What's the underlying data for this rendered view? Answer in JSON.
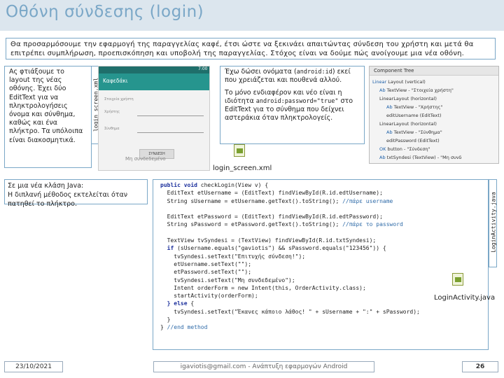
{
  "title": "Οθόνη σύνδεσης (login)",
  "intro": "Θα προσαρμόσουμε την εφαρμογή της παραγγελίας καφέ, έτσι ώστε να ξεκινάει απαιτώντας σύνδεση του χρήστη και μετά θα επιτρέπει συμπλήρωση, προεπισκόπηση και υποβολή της παραγγελίας. Στόχος είναι να δούμε πώς ανοίγουμε μια νέα οθόνη.",
  "left_note": "Ας φτιάξουμε το layout της νέας οθόνης. Έχει δύο EditText για να πληκτρολογήσεις όνομα και σύνθημα, καθώς και ένα πλήκτρο. Τα υπόλοιπα είναι διακοσμητικά.",
  "vertical_label_1": "login_screen.xml",
  "phone": {
    "time": "7:00",
    "app_title": "Καφεδάκι",
    "row1": "Στοιχεία χρήστη",
    "row2": "Χρήστης",
    "row3": "Σύνθημα",
    "button": "ΣΥΝΔΕΣΗ",
    "status": "Μη συνδεδεμένο"
  },
  "callout": {
    "p1_before": "Έχω δώσει ονόματα (",
    "p1_code": "android:id",
    "p1_after": ") εκεί που χρειάζεται και πουθενά αλλού.",
    "p2_before": "Το μόνο ενδιαφέρον και νέο είναι η ιδιότητα ",
    "p2_code": "android:password=\"true\"",
    "p2_after": " στο EditText για το σύνθημα που δείχνει αστεράκια όταν πληκτρολογείς."
  },
  "tree": {
    "header": "Component Tree",
    "items": [
      {
        "tag": "Linear",
        "rest": " Layout (vertical)"
      },
      {
        "tag": "Ab",
        "rest": " TextView - \"Στοιχεία χρήστη\""
      },
      {
        "tag": "",
        "rest": "LinearLayout (horizontal)"
      },
      {
        "tag": "Ab",
        "rest": " TextView - \"Χρήστης\""
      },
      {
        "tag": "",
        "rest": "editUsername (EditText)"
      },
      {
        "tag": "",
        "rest": "LinearLayout (horizontal)"
      },
      {
        "tag": "Ab",
        "rest": " TextView - \"Σύνθημα\""
      },
      {
        "tag": "",
        "rest": "editPassword (EditText)"
      },
      {
        "tag": "OK",
        "rest": " button - \"Σύνδεση\""
      },
      {
        "tag": "Ab",
        "rest": " txtSyndesi (TextView) - \"Μη συνδ"
      }
    ]
  },
  "file1": "login_screen.xml",
  "file2": "LoginActivity.java",
  "class_note_1": "Σε μια νέα κλάση Java:",
  "class_note_2": "Η διπλανή μέθοδος εκτελείται όταν πατηθεί το πλήκτρο.",
  "vertical_label_2": "LoginActivity.java",
  "code": [
    {
      "kw": "public void",
      "rest": " checkLogin(View v) {",
      "cm": ""
    },
    {
      "kw": "",
      "rest": "  EditText etUsername = (EditText) findViewById(R.id.edtUsername);",
      "cm": ""
    },
    {
      "kw": "",
      "rest": "  String sUsername = etUsername.getText().toString(); ",
      "cm": "//πάρε username"
    },
    {
      "kw": "",
      "rest": "",
      "cm": ""
    },
    {
      "kw": "",
      "rest": "  EditText etPassword = (EditText) findViewById(R.id.edtPassword);",
      "cm": ""
    },
    {
      "kw": "",
      "rest": "  String sPassword = etPassword.getText().toString(); ",
      "cm": "//πάρε το password"
    },
    {
      "kw": "",
      "rest": "",
      "cm": ""
    },
    {
      "kw": "",
      "rest": "  TextView tvSyndesi = (TextView) findViewById(R.id.txtSyndesi);",
      "cm": ""
    },
    {
      "kw": "  if",
      "rest": " (sUsername.equals(\"gaviotis\") && sPassword.equals(\"123456\")) {",
      "cm": ""
    },
    {
      "kw": "",
      "rest": "    tvSyndesi.setText(\"Επιτυχής σύνδεση!\");",
      "cm": ""
    },
    {
      "kw": "",
      "rest": "    etUsername.setText(\"\");",
      "cm": ""
    },
    {
      "kw": "",
      "rest": "    etPassword.setText(\"\");",
      "cm": ""
    },
    {
      "kw": "",
      "rest": "    tvSyndesi.setText(\"Μη συνδεδεμένο\");",
      "cm": ""
    },
    {
      "kw": "",
      "rest": "    Intent orderForm = new Intent(this, OrderActivity.class);",
      "cm": ""
    },
    {
      "kw": "",
      "rest": "    startActivity(orderForm);",
      "cm": ""
    },
    {
      "kw": "  } else",
      "rest": " {",
      "cm": ""
    },
    {
      "kw": "",
      "rest": "    tvSyndesi.setText(\"Έκανες κάποιο λάθος! \" + sUsername + \":\" + sPassword);",
      "cm": ""
    },
    {
      "kw": "",
      "rest": "  }",
      "cm": ""
    },
    {
      "kw": "",
      "rest": "} ",
      "cm": "//end method"
    }
  ],
  "footer": {
    "date": "23/10/2021",
    "center": "igaviotis@gmail.com - Ανάπτυξη εφαρμογών Android",
    "page": "26"
  }
}
